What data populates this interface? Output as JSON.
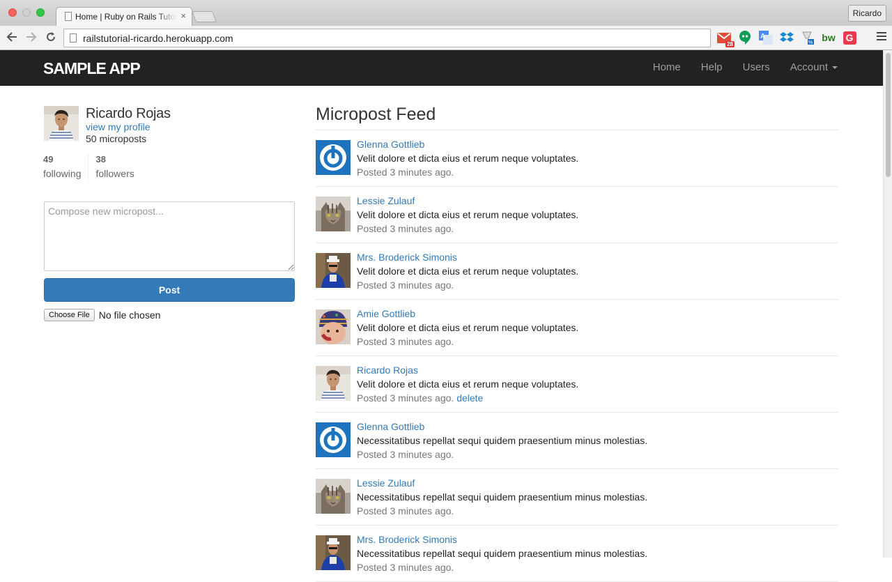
{
  "browser": {
    "tab_title": "Home | Ruby on Rails Tutorial Sample App",
    "url": "railstutorial-ricardo.herokuapp.com",
    "profile_name": "Ricardo",
    "gmail_badge": "28",
    "extensions": [
      "gmail-icon",
      "hangouts-icon",
      "translate-icon",
      "dropbox-icon",
      "discount-icon",
      "bw-icon",
      "grammarly-icon"
    ],
    "ext_labels": {
      "bw": "bw",
      "grammarly": "G",
      "translate": "A"
    }
  },
  "navbar": {
    "logo": "sample app",
    "links": [
      "Home",
      "Help",
      "Users",
      "Account"
    ],
    "bg_color": "#222222"
  },
  "user": {
    "name": "Ricardo Rojas",
    "view_profile": "view my profile",
    "microposts": "50 microposts",
    "following_count": "49",
    "following_label": "following",
    "followers_count": "38",
    "followers_label": "followers"
  },
  "compose": {
    "placeholder": "Compose new micropost...",
    "post_label": "Post",
    "choose_file": "Choose File",
    "file_status": "No file chosen"
  },
  "feed": {
    "title": "Micropost Feed",
    "items": [
      {
        "user": "Glenna Gottlieb",
        "avatar": "gravatar-icon",
        "content": "Velit dolore et dicta eius et rerum neque voluptates.",
        "time": "Posted 3 minutes ago.",
        "delete": ""
      },
      {
        "user": "Lessie Zulauf",
        "avatar": "cat-photo",
        "content": "Velit dolore et dicta eius et rerum neque voluptates.",
        "time": "Posted 3 minutes ago.",
        "delete": ""
      },
      {
        "user": "Mrs. Broderick Simonis",
        "avatar": "person-photo",
        "content": "Velit dolore et dicta eius et rerum neque voluptates.",
        "time": "Posted 3 minutes ago.",
        "delete": ""
      },
      {
        "user": "Amie Gottlieb",
        "avatar": "baby-photo",
        "content": "Velit dolore et dicta eius et rerum neque voluptates.",
        "time": "Posted 3 minutes ago.",
        "delete": ""
      },
      {
        "user": "Ricardo Rojas",
        "avatar": "ricardo-photo",
        "content": "Velit dolore et dicta eius et rerum neque voluptates.",
        "time": "Posted 3 minutes ago.",
        "delete": "delete"
      },
      {
        "user": "Glenna Gottlieb",
        "avatar": "gravatar-icon",
        "content": "Necessitatibus repellat sequi quidem praesentium minus molestias.",
        "time": "Posted 3 minutes ago.",
        "delete": ""
      },
      {
        "user": "Lessie Zulauf",
        "avatar": "cat-photo",
        "content": "Necessitatibus repellat sequi quidem praesentium minus molestias.",
        "time": "Posted 3 minutes ago.",
        "delete": ""
      },
      {
        "user": "Mrs. Broderick Simonis",
        "avatar": "person-photo",
        "content": "Necessitatibus repellat sequi quidem praesentium minus molestias.",
        "time": "Posted 3 minutes ago.",
        "delete": ""
      }
    ]
  },
  "colors": {
    "link": "#337ab7",
    "primary": "#337ab7",
    "gravatar_blue": "#1e73be"
  }
}
